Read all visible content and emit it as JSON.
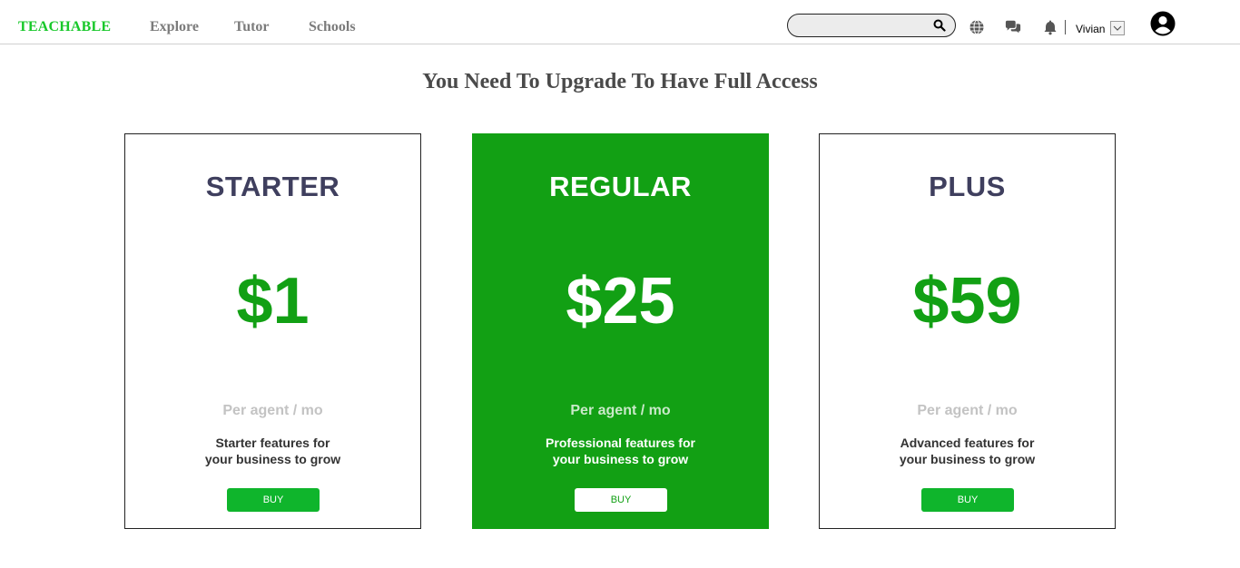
{
  "header": {
    "brand": "TEACHABLE",
    "nav": [
      "Explore",
      "Tutor",
      "Schools"
    ],
    "search": {
      "placeholder": "",
      "value": ""
    },
    "icons": [
      "search-icon",
      "globe-icon",
      "chat-icon",
      "bell-icon",
      "user-avatar-icon"
    ],
    "user_name": "Vivian"
  },
  "main": {
    "title": "You Need To Upgrade To Have Full Access",
    "plans": [
      {
        "name": "STARTER",
        "price": "$1",
        "period": "Per agent / mo",
        "description_line1": "Starter features for",
        "description_line2": "your business to grow",
        "button": "BUY"
      },
      {
        "name": "REGULAR",
        "price": "$25",
        "period": "Per agent / mo",
        "description_line1": "Professional features for",
        "description_line2": "your business to grow",
        "button": "BUY"
      },
      {
        "name": "PLUS",
        "price": "$59",
        "period": "Per agent / mo",
        "description_line1": "Advanced features for",
        "description_line2": "your business to grow",
        "button": "BUY"
      }
    ]
  },
  "colors": {
    "brand_green": "#18c82a",
    "accent_green": "#12a014",
    "button_green": "#0fb52c",
    "title_gray": "#4a4a4a",
    "plan_name_color": "#3f3f5e"
  }
}
